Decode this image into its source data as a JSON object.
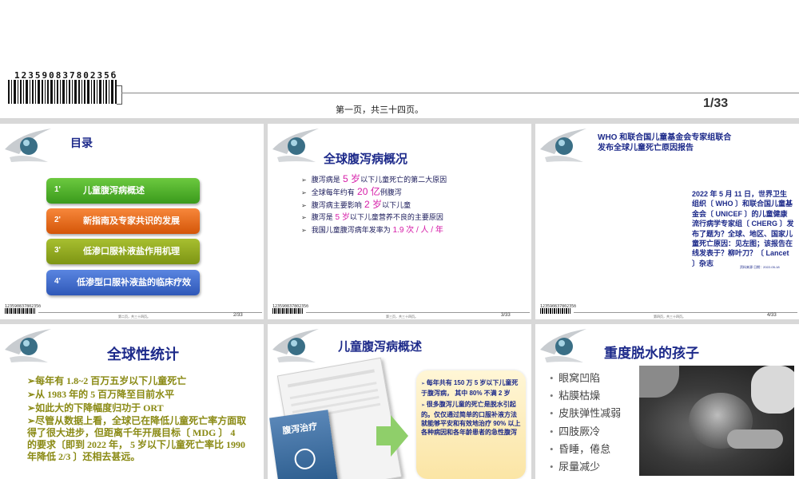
{
  "header": {
    "barcode_number": "12359083780235б",
    "page_text": "第一页，共三十四页。",
    "page_num": "1/33"
  },
  "slide2": {
    "title": "目录",
    "items": [
      {
        "num": "1'",
        "label": "儿童腹泻病概述",
        "color": "#4caa2a"
      },
      {
        "num": "2'",
        "label": "新指南及专家共识的发展",
        "color": "#e8650e"
      },
      {
        "num": "3'",
        "label": "低渗口服补液盐作用机理",
        "color": "#8ba21a"
      },
      {
        "num": "4'",
        "label": "低渗型口服补液盐的临床疗效",
        "color": "#3b67c7"
      }
    ],
    "footer_text": "第二页，共三十四页。",
    "page_num": "2/33",
    "barcode": "12359083780235б"
  },
  "slide3": {
    "title": "全球腹泻病概况",
    "bullets": [
      {
        "a": "腹泻病是",
        "hl": " 5 岁",
        "b": "以下儿童死亡的第二大原因"
      },
      {
        "a": "全球每年约有",
        "hl": " 20 亿",
        "b": "例腹泻"
      },
      {
        "a": "腹泻病主要影响",
        "hl": " 2 岁",
        "b": "以下儿童"
      },
      {
        "a": "腹泻是",
        "hl": " 5 岁",
        "b": "以下儿童营养不良的主要原因"
      },
      {
        "a": "我国儿童腹泻病年发率为",
        "hl": " 1.9 次 / 人 / 年",
        "b": ""
      }
    ],
    "footer_text": "第三页，共三十四页。",
    "page_num": "3/33",
    "barcode": "12359083780235б"
  },
  "slide4": {
    "title_line1": "WHO 和联合国儿童基金会专家组联合",
    "title_line2": "发布全球儿童死亡原因报告",
    "body": "2022 年 5 月 11 日，世界卫生组织〔 WHO 〕和联合国儿童基金会〔 UNICEF 〕的儿童健康流行病学专家组〔 CHERG 〕发布了题为？全球、地区、国家儿童死亡原因：见左图；该报告在线发表于？柳叶刀？〔 Lancet 〕杂志",
    "citation": "资料来源 日期：2022-05-18",
    "footer_text": "第四页，共三十四页。",
    "page_num": "4/33",
    "barcode": "12359083780235б"
  },
  "slide5": {
    "title": "全球性统计",
    "bullets": [
      "每年有 1.8~2 百万五岁以下儿童死亡",
      "从 1983 年的 5 百万降至目前水平",
      "如此大的下降幅度归功于 ORT",
      "尽管从数据上看，全球已在降低儿童死亡率方面取得了很大进步，但距离千年开展目标〔 MDG 〕 4 的要求〔即到 2022 年， 5 岁以下儿童死亡率比 1990 年降低 2/3 〕还相去甚远。"
    ]
  },
  "slide6": {
    "title": "儿童腹泻病概述",
    "bullets": [
      "每年共有 150 万 5 岁以下儿童死于腹泻病， 其中 80% 不满 2 岁",
      "很多腹泻儿童的死亡是脱水引起的。仅仅通过简单的口服补液方法就能够平安和有效地治疗 90% 以上各种病因和各年龄患者的急性腹泻"
    ],
    "book_title": "腹泻治疗"
  },
  "slide7": {
    "title": "重度脱水的孩子",
    "bullets": [
      "眼窝凹陷",
      "粘膜枯燥",
      "皮肤弹性减弱",
      "四肢厥冷",
      "昏睡，倦怠",
      "尿量减少"
    ]
  }
}
